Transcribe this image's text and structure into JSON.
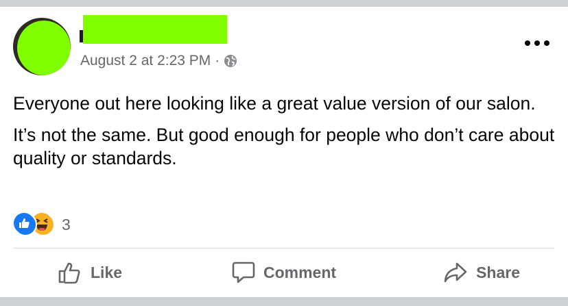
{
  "post": {
    "timestamp": "August 2 at 2:23 PM",
    "separator": "·",
    "privacy_icon": "globe-icon",
    "paragraphs": [
      "Everyone out here looking like a great value version of our salon.",
      "It’s not the same. But good enough for people who don’t care about quality or standards."
    ],
    "reactions": {
      "icons": [
        "like-reaction-icon",
        "haha-reaction-icon"
      ],
      "count": "3"
    }
  },
  "actions": {
    "like_label": "Like",
    "comment_label": "Comment",
    "share_label": "Share"
  },
  "colors": {
    "redaction": "#80ff00",
    "secondary_text": "#65676b",
    "like_blue": "#1877f2",
    "haha_yellow": "#f7b125"
  }
}
